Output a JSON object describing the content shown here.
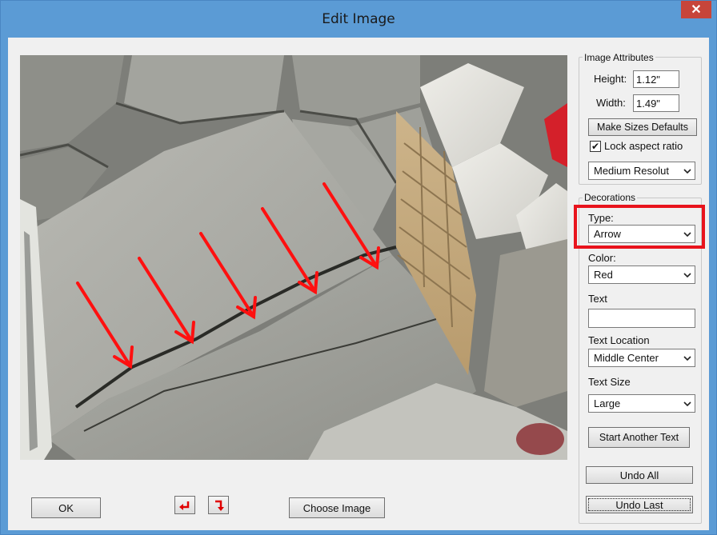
{
  "window": {
    "title": "Edit Image",
    "close_glyph": "✕"
  },
  "image_attributes": {
    "group_label": "Image Attributes",
    "height_label": "Height:",
    "height_value": "1.12\"",
    "width_label": "Width:",
    "width_value": "1.49\"",
    "make_defaults_label": "Make Sizes Defaults",
    "lock_aspect_label": "Lock aspect ratio",
    "lock_aspect_checked": true,
    "resolution_value": "Medium Resolut"
  },
  "decorations": {
    "group_label": "Decorations",
    "type_label": "Type:",
    "type_value": "Arrow",
    "color_label": "Color:",
    "color_value": "Red",
    "text_label": "Text",
    "text_value": "",
    "text_location_label": "Text Location",
    "text_location_value": "Middle Center",
    "text_size_label": "Text Size",
    "text_size_value": "Large",
    "start_another_label": "Start Another Text",
    "undo_all_label": "Undo All",
    "undo_last_label": "Undo Last"
  },
  "bottom": {
    "ok_label": "OK",
    "rotate_left_icon": "rotate-left-icon",
    "rotate_right_icon": "rotate-right-icon",
    "choose_image_label": "Choose Image"
  },
  "colors": {
    "title_bar": "#5b9bd5",
    "close_button": "#c7453a",
    "arrow": "#ff1010",
    "highlight": "#e8131c"
  },
  "photo": {
    "description_icon": "sidewalk-photo",
    "arrow_count": 5
  }
}
